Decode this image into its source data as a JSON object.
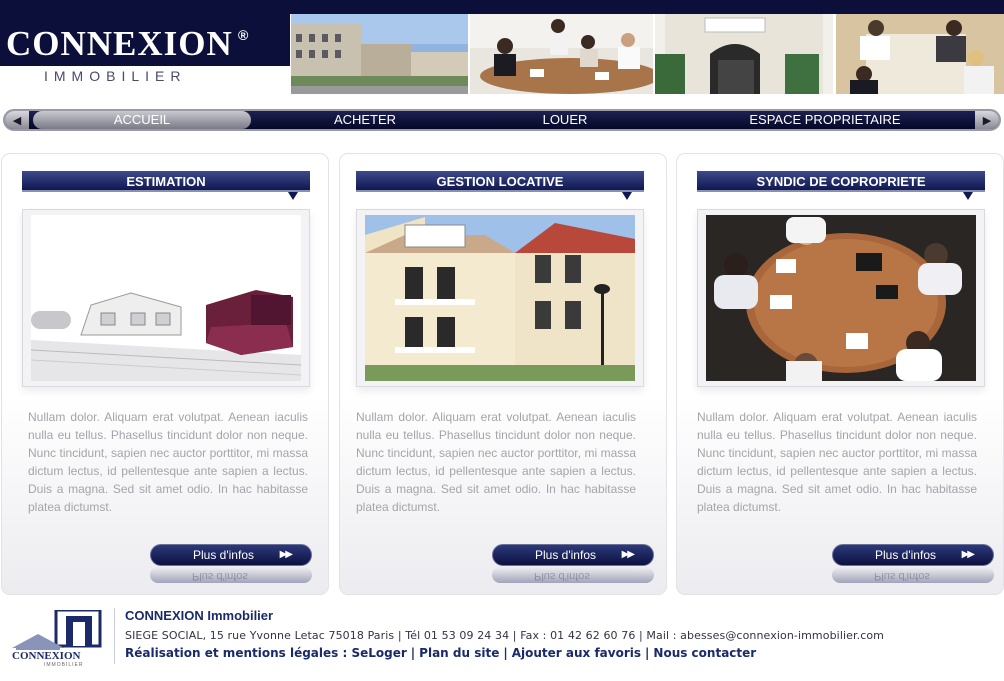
{
  "header": {
    "logo_title": "CONNEXION",
    "logo_registered": "®",
    "logo_subtitle": "IMMOBILIER"
  },
  "nav": {
    "items": [
      {
        "label": "ACCUEIL",
        "active": true
      },
      {
        "label": "ACHETER",
        "active": false
      },
      {
        "label": "LOUER",
        "active": false
      },
      {
        "label": "ESPACE PROPRIETAIRE",
        "active": false
      }
    ]
  },
  "panels": [
    {
      "title": "ESTIMATION",
      "text": "Nullam dolor. Aliquam erat volutpat. Aenean iaculis nulla eu tellus. Phasellus tincidunt dolor non neque. Nunc tincidunt, sapien nec auctor porttitor, mi massa dictum lectus, id pellentesque ante sapien a lectus. Duis a magna. Sed sit amet odio. In hac habitasse platea dictumst.",
      "button": "Plus d'infos"
    },
    {
      "title": "GESTION LOCATIVE",
      "text": "Nullam dolor. Aliquam erat volutpat. Aenean iaculis nulla eu tellus. Phasellus tincidunt dolor non neque. Nunc tincidunt, sapien nec auctor porttitor, mi massa dictum lectus, id pellentesque ante sapien a lectus. Duis a magna. Sed sit amet odio. In hac habitasse platea dictumst.",
      "button": "Plus d'infos"
    },
    {
      "title": "SYNDIC DE COPROPRIETE",
      "text": "Nullam dolor. Aliquam erat volutpat. Aenean iaculis nulla eu tellus. Phasellus tincidunt dolor non neque. Nunc tincidunt, sapien nec auctor porttitor, mi massa dictum lectus, id pellentesque ante sapien a lectus. Duis a magna. Sed sit amet odio. In hac habitasse platea dictumst.",
      "button": "Plus d'infos"
    }
  ],
  "footer": {
    "logo_text": "CONNEXION",
    "logo_sub": "IMMOBILIER",
    "company": "CONNEXION Immobilier",
    "address": "SIEGE SOCIAL, 15 rue Yvonne Letac 75018 Paris | Tél 01 53 09 24 34 | Fax : 01 42 62 60 76 | Mail : abesses@connexion-immobilier.com",
    "links_prefix": "Réalisation et mentions légales : ",
    "links": [
      "SeLoger",
      "Plan du site",
      "Ajouter aux favoris",
      "Nous contacter"
    ]
  },
  "colors": {
    "brand_navy": "#0b0f3a",
    "title_blue": "#1a2a6a",
    "body_grey": "#a4a4aa"
  }
}
